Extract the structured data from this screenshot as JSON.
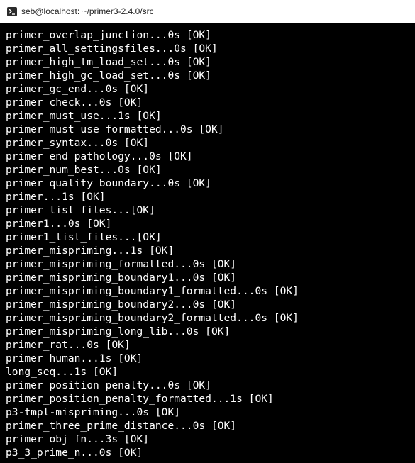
{
  "window": {
    "title": "seb@localhost: ~/primer3-2.4.0/src",
    "icon": "terminal-icon"
  },
  "terminal": {
    "lines": [
      "primer_overlap_junction...0s [OK]",
      "primer_all_settingsfiles...0s [OK]",
      "primer_high_tm_load_set...0s [OK]",
      "primer_high_gc_load_set...0s [OK]",
      "primer_gc_end...0s [OK]",
      "primer_check...0s [OK]",
      "primer_must_use...1s [OK]",
      "primer_must_use_formatted...0s [OK]",
      "primer_syntax...0s [OK]",
      "primer_end_pathology...0s [OK]",
      "primer_num_best...0s [OK]",
      "primer_quality_boundary...0s [OK]",
      "primer...1s [OK]",
      "primer_list_files...[OK]",
      "primer1...0s [OK]",
      "primer1_list_files...[OK]",
      "primer_mispriming...1s [OK]",
      "primer_mispriming_formatted...0s [OK]",
      "primer_mispriming_boundary1...0s [OK]",
      "primer_mispriming_boundary1_formatted...0s [OK]",
      "primer_mispriming_boundary2...0s [OK]",
      "primer_mispriming_boundary2_formatted...0s [OK]",
      "primer_mispriming_long_lib...0s [OK]",
      "primer_rat...0s [OK]",
      "primer_human...1s [OK]",
      "long_seq...1s [OK]",
      "primer_position_penalty...0s [OK]",
      "primer_position_penalty_formatted...1s [OK]",
      "p3-tmpl-mispriming...0s [OK]",
      "primer_three_prime_distance...0s [OK]",
      "primer_obj_fn...3s [OK]",
      "p3_3_prime_n...0s [OK]"
    ],
    "colors": {
      "background": "#000000",
      "foreground": "#ffffff"
    }
  }
}
